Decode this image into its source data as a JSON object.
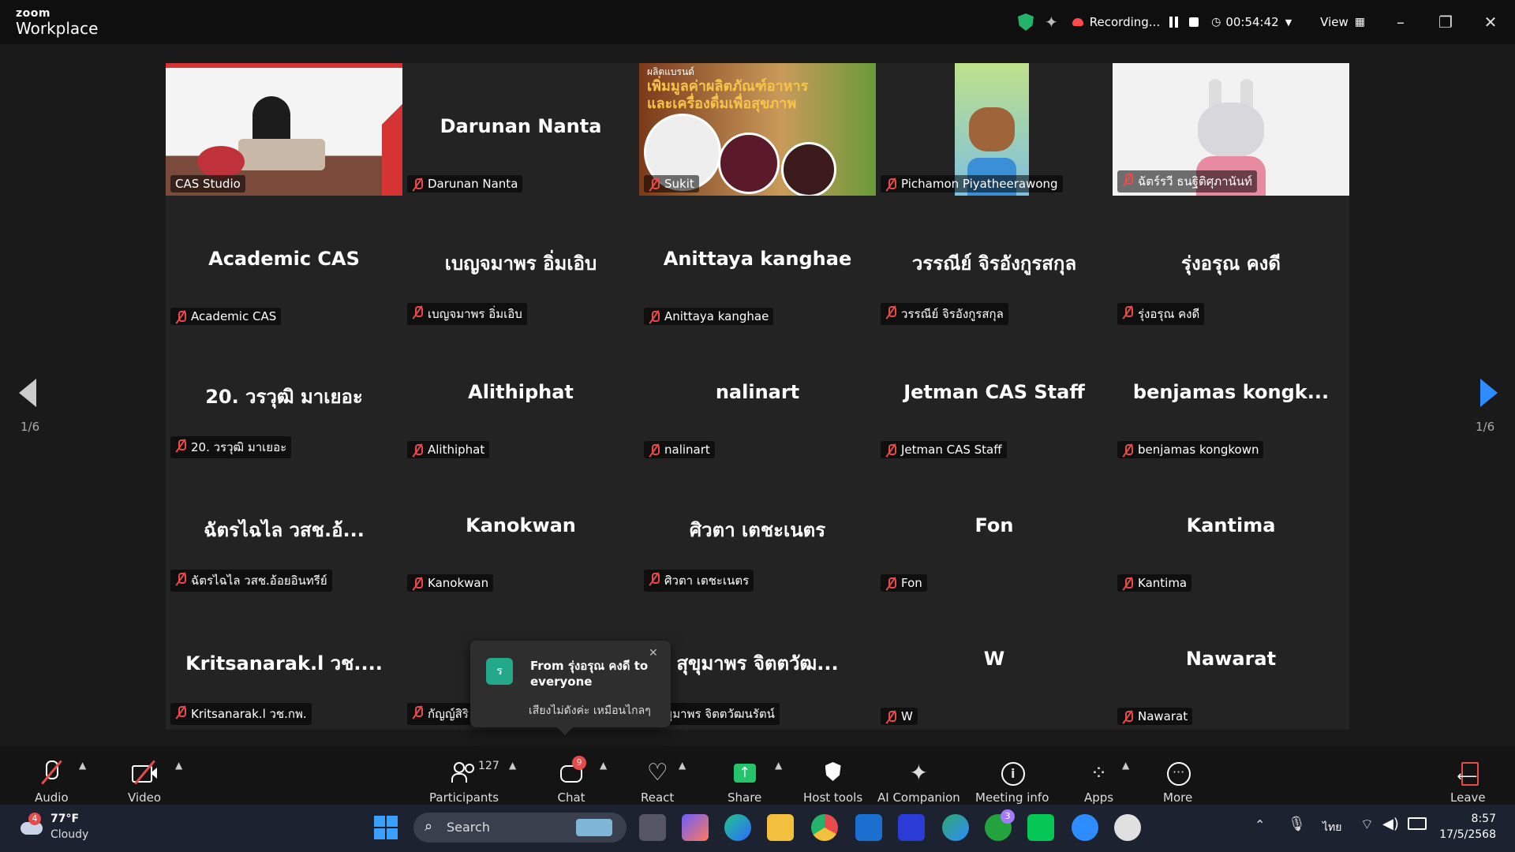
{
  "app": {
    "brand_small": "zoom",
    "brand_big": "Workplace"
  },
  "titlebar": {
    "recording_label": "Recording...",
    "timer": "00:54:42",
    "view_label": "View"
  },
  "pager": {
    "left": "1/6",
    "right": "1/6"
  },
  "tiles": [
    {
      "big": "",
      "label": "CAS Studio"
    },
    {
      "big": "Darunan Nanta",
      "label": "Darunan Nanta"
    },
    {
      "big": "",
      "label": "Sukit"
    },
    {
      "big": "",
      "label": "Pichamon Piyatheerawong"
    },
    {
      "big": "",
      "label": "ฉัตร์รวี ธนฐิติศุภานันท์"
    },
    {
      "big": "Academic CAS",
      "label": "Academic CAS"
    },
    {
      "big": "เบญจมาพร อิ่มเอิบ",
      "label": "เบญจมาพร อิ่มเอิบ"
    },
    {
      "big": "Anittaya kanghae",
      "label": "Anittaya kanghae"
    },
    {
      "big": "วรรณีย์ จิรอังกูรสกุล",
      "label": "วรรณีย์ จิรอังกูรสกุล"
    },
    {
      "big": "รุ่งอรุณ คงดี",
      "label": "รุ่งอรุณ คงดี"
    },
    {
      "big": "20. วรวุฒิ มาเยอะ",
      "label": "20. วรวุฒิ มาเยอะ"
    },
    {
      "big": "Alithiphat",
      "label": "Alithiphat"
    },
    {
      "big": "nalinart",
      "label": "nalinart"
    },
    {
      "big": "Jetman CAS Staff",
      "label": "Jetman CAS Staff"
    },
    {
      "big": "benjamas kongk...",
      "label": "benjamas kongkown"
    },
    {
      "big": "ฉัตรไฉไล วสช.อ้...",
      "label": "ฉัตรไฉไล วสช.อ้อยอินทรีย์"
    },
    {
      "big": "Kanokwan",
      "label": "Kanokwan"
    },
    {
      "big": "ศิวตา เตชะเนตร",
      "label": "ศิวตา เตชะเนตร"
    },
    {
      "big": "Fon",
      "label": "Fon"
    },
    {
      "big": "Kantima",
      "label": "Kantima"
    },
    {
      "big": "Kritsanarak.l วช....",
      "label": "Kritsanarak.l วช.กพ."
    },
    {
      "big": "กัญ",
      "label": "กัญญ์สิริ"
    },
    {
      "big": "สุขุมาพร จิตตวัฒ...",
      "label": "ขุมาพร จิตตวัฒนรัตน์"
    },
    {
      "big": "W",
      "label": "W"
    },
    {
      "big": "Nawarat",
      "label": "Nawarat"
    }
  ],
  "slide_text": {
    "line1": "เพิ่มมูลค่าผลิตภัณฑ์อาหาร",
    "line2": "และเครื่องดื่มเพื่อสุขภาพ",
    "top": "ผลิตแบรนด์"
  },
  "notification": {
    "avatar": "ร",
    "title": "From รุ่งอรุณ คงดี to everyone",
    "message": "เสียงไม่ดังค่ะ เหมือนไกลๆ"
  },
  "toolbar": {
    "audio": "Audio",
    "video": "Video",
    "participants": "Participants",
    "participants_count": "127",
    "chat": "Chat",
    "chat_badge": "9",
    "react": "React",
    "share": "Share",
    "host_tools": "Host tools",
    "ai_companion": "AI Companion",
    "meeting_info": "Meeting info",
    "apps": "Apps",
    "more": "More",
    "leave": "Leave"
  },
  "taskbar": {
    "weather_temp": "77°F",
    "weather_desc": "Cloudy",
    "weather_badge": "4",
    "search": "Search",
    "xbox_badge": "3",
    "lang": "ไทย",
    "time": "8:57",
    "date": "17/5/2568"
  },
  "colors": {
    "accent_green": "#2bd67b",
    "mic_red": "#e84b4b",
    "zoom_blue": "#2d8cff"
  }
}
